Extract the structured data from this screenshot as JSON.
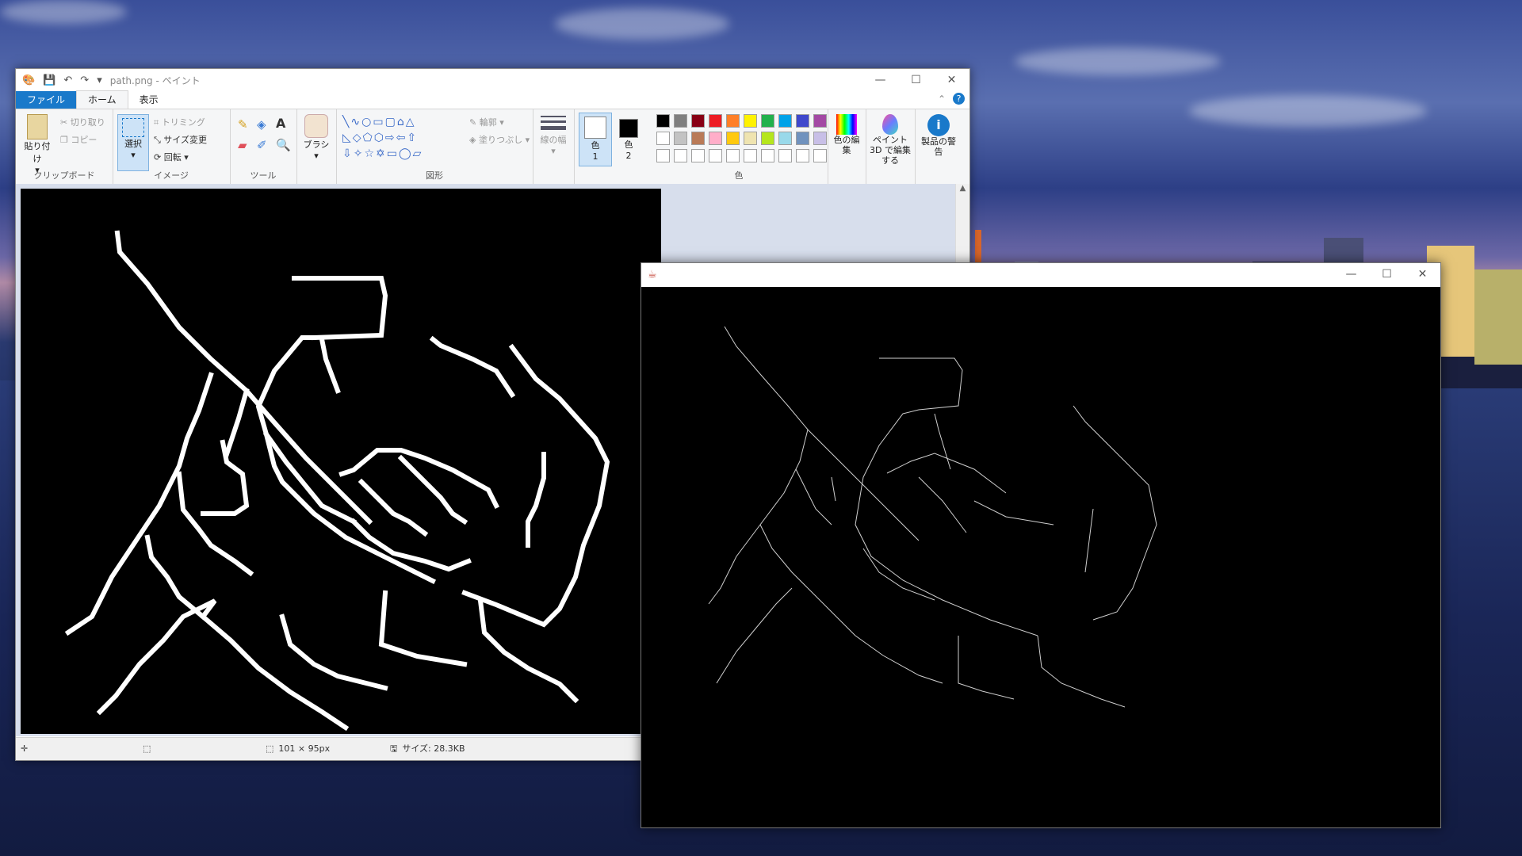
{
  "paint": {
    "title": "path.png - ペイント",
    "tabs": [
      "ファイル",
      "ホーム",
      "表示"
    ],
    "clipboard": {
      "paste": "貼り付け",
      "cut": "切り取り",
      "copy": "コピー",
      "label": "クリップボード"
    },
    "image": {
      "select": "選択",
      "crop": "トリミング",
      "resize": "サイズ変更",
      "rotate": "回転",
      "label": "イメージ"
    },
    "tools": {
      "label": "ツール"
    },
    "brush": {
      "label": "ブラシ"
    },
    "shapes": {
      "outline": "輪郭",
      "fill": "塗りつぶし",
      "label": "図形"
    },
    "size": {
      "label": "線の幅"
    },
    "color1": {
      "label": "色",
      "sub": "1"
    },
    "color2": {
      "label": "色",
      "sub": "2"
    },
    "colors": {
      "label": "色",
      "row1": [
        "#000000",
        "#7f7f7f",
        "#880015",
        "#ed1c24",
        "#ff7f27",
        "#fff200",
        "#22b14c",
        "#00a2e8",
        "#3f48cc",
        "#a349a4"
      ],
      "row2": [
        "#ffffff",
        "#c3c3c3",
        "#b97a57",
        "#ffaec9",
        "#ffc90e",
        "#efe4b0",
        "#b5e61d",
        "#99d9ea",
        "#7092be",
        "#c8bfe7"
      ],
      "row3": [
        "#ffffff",
        "#ffffff",
        "#ffffff",
        "#ffffff",
        "#ffffff",
        "#ffffff",
        "#ffffff",
        "#ffffff",
        "#ffffff",
        "#ffffff"
      ]
    },
    "edit_colors": "色の編集",
    "paint3d": "ペイント 3D で編集する",
    "product_alert": "製品の警告",
    "status": {
      "dimensions": "101 × 95px",
      "size": "サイズ: 28.3KB"
    }
  }
}
